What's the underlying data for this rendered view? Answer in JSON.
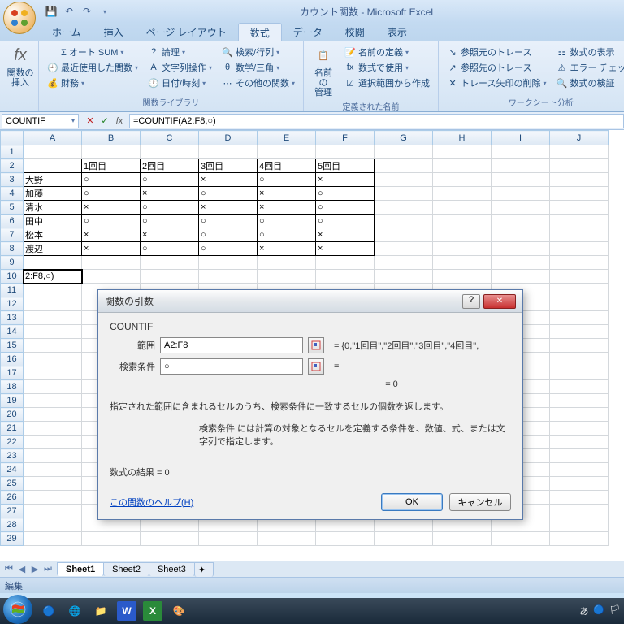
{
  "title": "カウント関数 - Microsoft Excel",
  "tabs": {
    "home": "ホーム",
    "insert": "挿入",
    "layout": "ページ レイアウト",
    "formulas": "数式",
    "data": "データ",
    "review": "校閲",
    "view": "表示"
  },
  "ribbon": {
    "fx_label": "関数の\n挿入",
    "autosum": "Σ オート SUM",
    "recent": "最近使用した関数",
    "financial": "財務",
    "logical": "論理",
    "text": "文字列操作",
    "datetime": "日付/時刻",
    "lookup": "検索/行列",
    "math": "数学/三角",
    "other": "その他の関数",
    "lib_group": "関数ライブラリ",
    "name_mgr": "名前の\n管理",
    "define_name": "名前の定義",
    "use_in_formula": "数式で使用",
    "create_from_sel": "選択範囲から作成",
    "names_group": "定義された名前",
    "trace_prec": "参照元のトレース",
    "trace_dep": "参照先のトレース",
    "remove_arrows": "トレース矢印の削除",
    "show_formulas": "数式の表示",
    "error_check": "エラー チェック",
    "evaluate": "数式の検証",
    "audit_group": "ワークシート分析"
  },
  "name_box": "COUNTIF",
  "formula": "=COUNTIF(A2:F8,○)",
  "columns": [
    "A",
    "B",
    "C",
    "D",
    "E",
    "F",
    "G",
    "H",
    "I",
    "J"
  ],
  "data_table": {
    "headers": [
      "",
      "1回目",
      "2回目",
      "3回目",
      "4回目",
      "5回目"
    ],
    "rows": [
      [
        "大野",
        "○",
        "○",
        "×",
        "○",
        "×"
      ],
      [
        "加藤",
        "○",
        "×",
        "○",
        "×",
        "○"
      ],
      [
        "清水",
        "×",
        "○",
        "×",
        "×",
        "○"
      ],
      [
        "田中",
        "○",
        "○",
        "○",
        "○",
        "○"
      ],
      [
        "松本",
        "×",
        "×",
        "○",
        "○",
        "×"
      ],
      [
        "渡辺",
        "×",
        "○",
        "○",
        "×",
        "×"
      ]
    ]
  },
  "a10_value": "2:F8,○)",
  "sheets": {
    "s1": "Sheet1",
    "s2": "Sheet2",
    "s3": "Sheet3"
  },
  "status": "編集",
  "dialog": {
    "title": "関数の引数",
    "func": "COUNTIF",
    "arg1_label": "範囲",
    "arg1_value": "A2:F8",
    "arg1_result": "= {0,\"1回目\",\"2回目\",\"3回目\",\"4回目\",",
    "arg2_label": "検索条件",
    "arg2_value": "○",
    "arg2_result": "=",
    "eq_zero": "= 0",
    "desc": "指定された範囲に含まれるセルのうち、検索条件に一致するセルの個数を返します。",
    "desc_sub": "検索条件 には計算の対象となるセルを定義する条件を、数値、式、または文字列で指定します。",
    "result": "数式の結果 = 0",
    "help_link": "この関数のヘルプ(H)",
    "ok": "OK",
    "cancel": "キャンセル"
  },
  "ime": "あ"
}
